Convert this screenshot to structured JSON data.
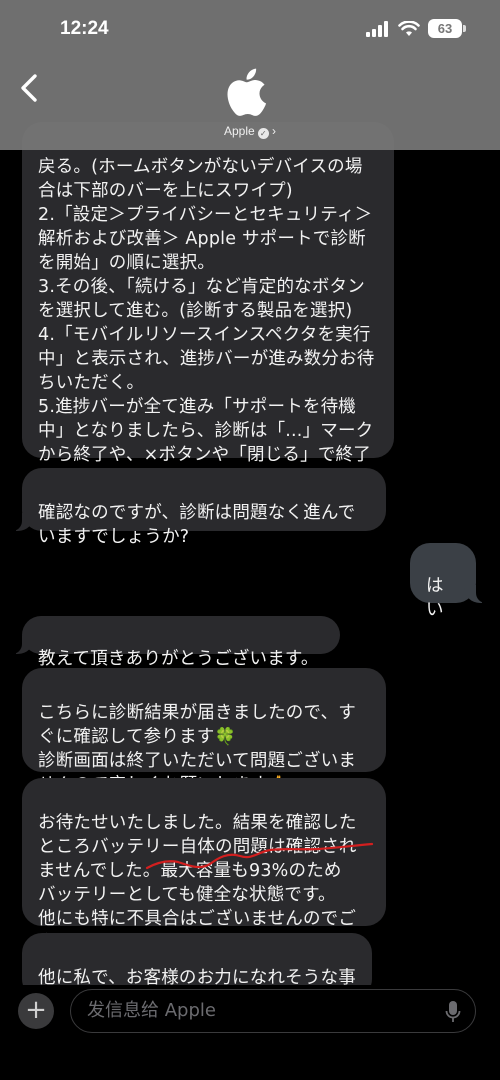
{
  "status_bar": {
    "time": "12:24",
    "battery": "63"
  },
  "header": {
    "contact_name": "Apple",
    "chevron": "›",
    "avatar_icon": "apple-logo-icon",
    "back_icon": "chevron-left-icon"
  },
  "messages": [
    {
      "direction": "incoming",
      "text": "戻る。(ホームボタンがないデバイスの場合は下部のバーを上にスワイプ)\n2.「設定＞プライバシーとセキュリティ＞解析および改善＞ Apple サポートで診断を開始」の順に選択。\n3.その後、「続ける」など肯定的なボタンを選択して進む。(診断する製品を選択)\n4.「モバイルリソースインスペクタを実行中」と表示され、進捗バーが進み数分お待ちいただく。\n5.進捗バーが全て進み「サポートを待機中」となりましたら、診断は「...」マークから終了や、×ボタンや「閉じる」で終了して結構です。"
    },
    {
      "direction": "incoming",
      "text": "確認なのですが、診断は問題なく進んでいますでしょうか?"
    },
    {
      "direction": "outgoing",
      "text": "はい"
    },
    {
      "direction": "incoming",
      "text": "教えて頂きありがとうございます。"
    },
    {
      "direction": "incoming",
      "text_a": "こちらに診断結果が届きましたので、すぐに確認して参ります",
      "emoji_a": "🍀",
      "text_b": "診断画面は終了いただいて問題ございませんので宜しくお願いします",
      "emoji_b": "🙏"
    },
    {
      "direction": "incoming",
      "text_a": "お待たせいたしました。結果を確認したところバッテリー自体の問題は確認されませんでした。",
      "text_underlined": "最大容量も93%のため",
      "text_b": "バッテリーとしても健全な状態です。\n他にも特に不具合はございませんのでご安心下さいませ",
      "emoji": "😁"
    },
    {
      "direction": "incoming",
      "text": "他に私で、お客様のお力になれそうな事はございますか?"
    }
  ],
  "composer": {
    "placeholder": "发信息给 Apple",
    "plus_label": "+"
  },
  "colors": {
    "incoming_bubble": "#2a2a2d",
    "outgoing_bubble": "#3b4046",
    "annotation_underline": "#d21f1f",
    "header_bg": "#787878"
  }
}
